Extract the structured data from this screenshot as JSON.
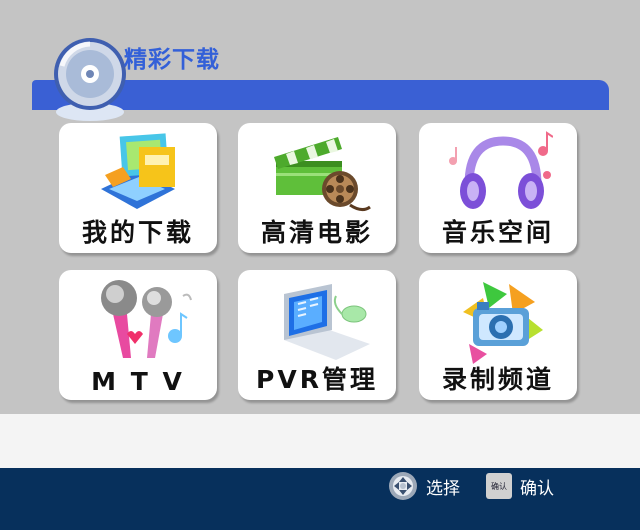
{
  "header": {
    "title": "精彩下载",
    "icon": "cd-disc-icon"
  },
  "tiles": [
    {
      "label": "我的下载",
      "icon": "downloads-folder-icon"
    },
    {
      "label": "高清电影",
      "icon": "film-clapper-icon"
    },
    {
      "label": "音乐空间",
      "icon": "headphones-icon"
    },
    {
      "label": "M T V",
      "icon": "microphones-icon"
    },
    {
      "label": "PVR管理",
      "icon": "laptop-icon"
    },
    {
      "label": "录制频道",
      "icon": "camera-icon"
    }
  ],
  "footer": {
    "select_label": "选择",
    "confirm_key": "确认",
    "confirm_label": "确认"
  },
  "colors": {
    "accent": "#3a60d4",
    "background": "#c4c4c4",
    "footer": "#07305c"
  }
}
